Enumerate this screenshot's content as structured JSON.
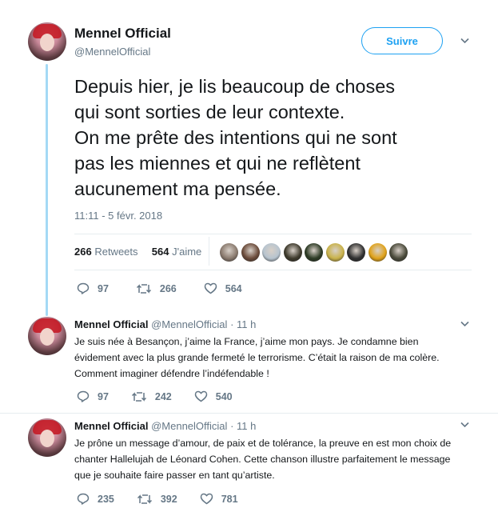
{
  "tweet": {
    "author_name": "Mennel Official",
    "author_handle": "@MennelOfficial",
    "follow_label": "Suivre",
    "text": "Depuis hier, je lis beaucoup de choses\nqui sont sorties de leur contexte.\nOn me prête des intentions qui ne sont\npas les miennes et qui ne reflètent\naucunement ma pensée.",
    "timestamp": "11:11 - 5 févr. 2018",
    "retweets_count": "266",
    "retweets_label": "Retweets",
    "likes_count": "564",
    "likes_label": "J'aime",
    "liker_avatars": [
      "#8a7a6e",
      "#6b4b3a",
      "#b7c4cf",
      "#3e3a2c",
      "#2d3b25",
      "#c9b24a",
      "#303030",
      "#e0a21a",
      "#4a4a3a"
    ],
    "actions": {
      "replies": "97",
      "retweets": "266",
      "likes": "564"
    }
  },
  "replies": [
    {
      "author_name": "Mennel Official",
      "author_handle": "@MennelOfficial",
      "time": "11 h",
      "text": "Je suis née à Besançon, j’aime la France, j’aime mon pays. Je condamne bien évidement avec la plus grande fermeté le terrorisme. C’était la raison de ma colère. Comment imaginer défendre l’indéfendable !",
      "actions": {
        "replies": "97",
        "retweets": "242",
        "likes": "540"
      }
    },
    {
      "author_name": "Mennel Official",
      "author_handle": "@MennelOfficial",
      "time": "11 h",
      "text": "Je prône un message d’amour, de paix et de tolérance, la preuve en est mon choix de chanter Hallelujah de Léonard Cohen. Cette chanson illustre parfaitement le message que je souhaite faire passer en tant qu’artiste.",
      "actions": {
        "replies": "235",
        "retweets": "392",
        "likes": "781"
      }
    }
  ],
  "colors": {
    "accent": "#1da1f2",
    "muted": "#657786",
    "thread": "#a4d9f5"
  }
}
